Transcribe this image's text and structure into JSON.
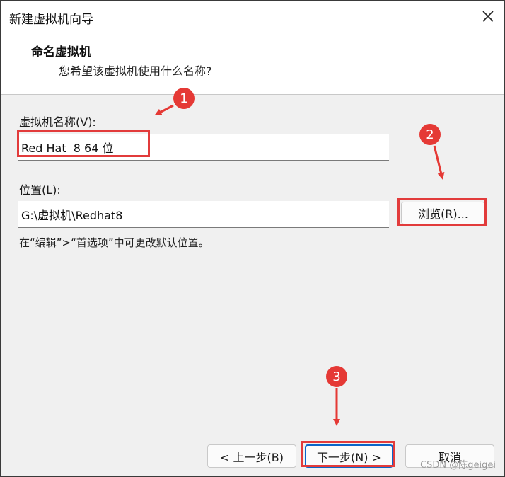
{
  "window": {
    "title": "新建虚拟机向导",
    "close_icon": "close-icon"
  },
  "header": {
    "title": "命名虚拟机",
    "subtitle": "您希望该虚拟机使用什么名称?"
  },
  "form": {
    "vm_name_label": "虚拟机名称(V):",
    "vm_name_value": "Red Hat  8 64 位",
    "location_label": "位置(L):",
    "location_value": "G:\\虚拟机\\Redhat8",
    "browse_label": "浏览(R)...",
    "hint": "在“编辑”>“首选项”中可更改默认位置。"
  },
  "footer": {
    "back_label": "< 上一步(B)",
    "next_label": "下一步(N) >",
    "cancel_label": "取消"
  },
  "annotations": {
    "markers": [
      "1",
      "2",
      "3"
    ],
    "color": "#e53935"
  },
  "watermark": "CSDN @陈geigei"
}
